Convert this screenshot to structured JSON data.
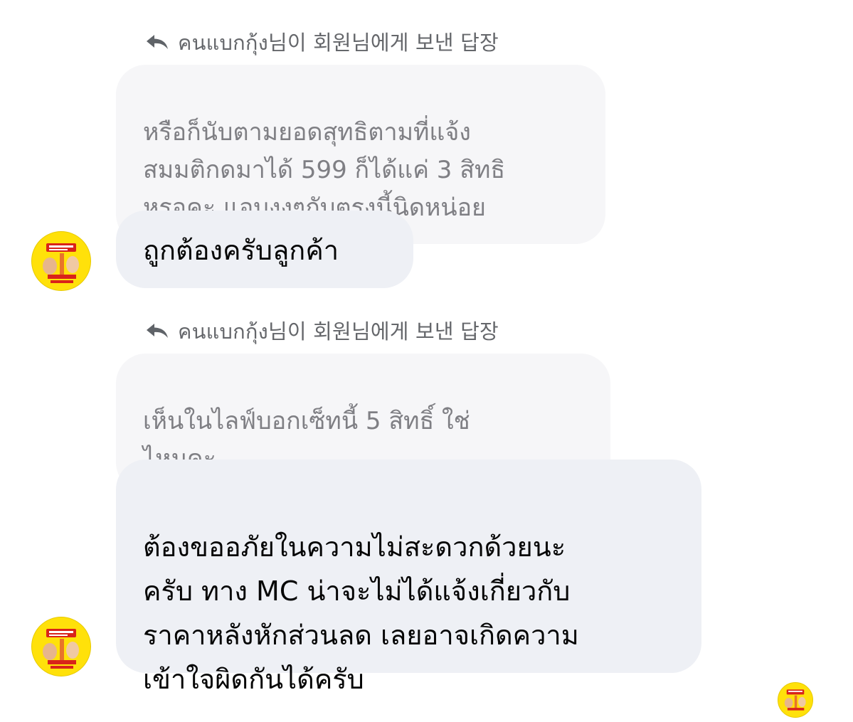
{
  "messages": [
    {
      "reply_header": "คนแบกกุ้ง님이 회원님에게 보낸 답장",
      "quoted_text": "หรือก็นับตามยอดสุทธิตามที่แจ้ง\nสมมติกดมาได้ 599 ก็ได้แค่ 3 สิทธิ\nหรอคะ แอบงงๆกับตรงนี้นิดหน่อย",
      "reply_text": "ถูกต้องครับลูกค้า"
    },
    {
      "reply_header": "คนแบกกุ้ง님이 회원님에게 보낸 답장",
      "quoted_text": "เห็นในไลฟ์บอกเซ็ทนี้ 5 สิทธิ์ ใช่\nไหมคะ",
      "reply_text": "ต้องขออภัยในความไม่สะดวกด้วยนะ\nครับ ทาง MC น่าจะไม่ได้แจ้งเกี่ยวกับ\nราคาหลังหักส่วนลด เลยอาจเกิดความ\nเข้าใจผิดกันได้ครับ"
    }
  ],
  "colors": {
    "avatar_background": "#ffe10a",
    "avatar_brand_red": "#d9231a",
    "quoted_bubble": "#f6f6f8",
    "reply_bubble": "#eef0f5",
    "header_text": "#65676b"
  },
  "icons": {
    "reply": "reply-arrow-icon",
    "avatar": "shop-avatar"
  }
}
